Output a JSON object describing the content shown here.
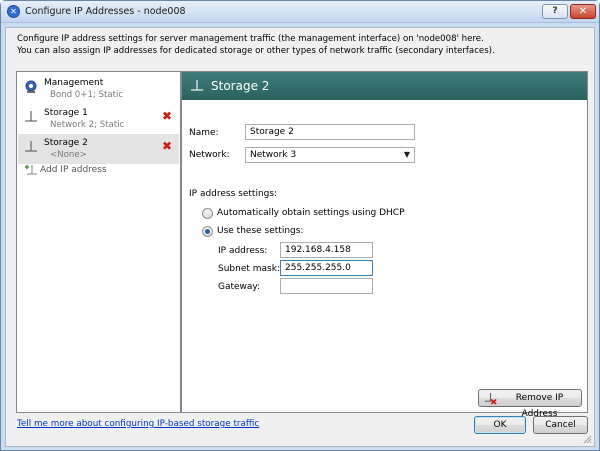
{
  "window": {
    "title": "Configure IP Addresses - node008",
    "help_label": "?",
    "close_label": "✕"
  },
  "description": {
    "line1": "Configure IP address settings for server management traffic (the management interface) on 'node008' here.",
    "line2": "You can also assign IP addresses for dedicated storage or other types of network traffic (secondary interfaces)."
  },
  "sidebar": {
    "items": [
      {
        "title": "Management",
        "subtitle": "Bond 0+1; Static",
        "icon": "management-icon",
        "deletable": false
      },
      {
        "title": "Storage 1",
        "subtitle": "Network 2; Static",
        "icon": "network-adapter-icon",
        "deletable": true
      },
      {
        "title": "Storage 2",
        "subtitle": "<None>",
        "icon": "network-adapter-icon",
        "deletable": true,
        "selected": true
      }
    ],
    "add_label": "Add IP address"
  },
  "detail": {
    "header_title": "Storage 2",
    "name_label": "Name:",
    "name_value": "Storage 2",
    "network_label": "Network:",
    "network_value": "Network 3",
    "ip_settings_label": "IP address settings:",
    "dhcp_option": "Automatically obtain settings using DHCP",
    "static_option": "Use these settings:",
    "selected_option": "static",
    "ip_label": "IP address:",
    "ip_value": "192.168.4.158",
    "subnet_label": "Subnet mask:",
    "subnet_value": "255.255.255.0",
    "gateway_label": "Gateway:",
    "gateway_value": "",
    "remove_label": "Remove IP Address"
  },
  "footer": {
    "link_text": "Tell me more about configuring IP-based storage traffic",
    "ok_label": "OK",
    "cancel_label": "Cancel"
  },
  "colors": {
    "header_bar": "#2f6b68",
    "link": "#0033cc",
    "delete": "#d21a0e"
  }
}
